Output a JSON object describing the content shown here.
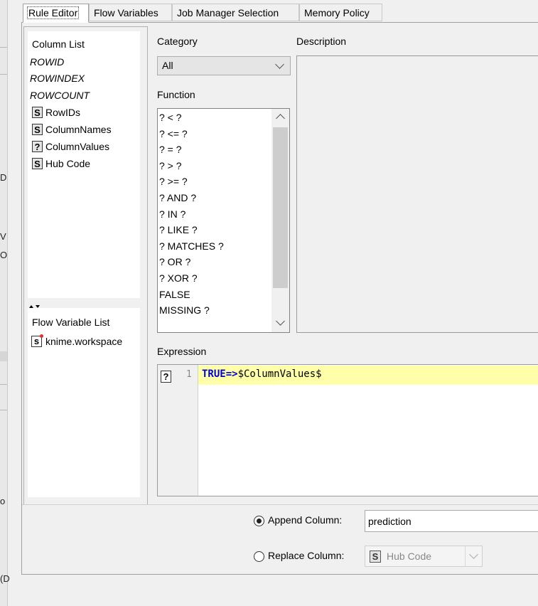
{
  "tabs": [
    {
      "label": "Rule Editor",
      "active": true
    },
    {
      "label": "Flow Variables"
    },
    {
      "label": "Job Manager Selection"
    },
    {
      "label": "Memory Policy"
    }
  ],
  "background_fragments": [
    "D",
    "V",
    "O",
    "o",
    "(D"
  ],
  "column_list": {
    "title": "Column List",
    "specials": [
      "ROWID",
      "ROWINDEX",
      "ROWCOUNT"
    ],
    "columns": [
      {
        "type": "S",
        "name": "RowIDs"
      },
      {
        "type": "S",
        "name": "ColumnNames"
      },
      {
        "type": "?",
        "name": "ColumnValues"
      },
      {
        "type": "S",
        "name": "Hub Code"
      }
    ]
  },
  "flow_variable_list": {
    "title": "Flow Variable List",
    "items": [
      {
        "type": "s",
        "name": "knime.workspace"
      }
    ]
  },
  "category": {
    "label": "Category",
    "value": "All"
  },
  "function": {
    "label": "Function",
    "items": [
      "? < ?",
      "? <= ?",
      "? = ?",
      "? > ?",
      "? >= ?",
      "? AND ?",
      "? IN ?",
      "? LIKE ?",
      "? MATCHES ?",
      "? OR ?",
      "? XOR ?",
      "FALSE",
      "MISSING ?"
    ]
  },
  "description": {
    "label": "Description"
  },
  "expression": {
    "label": "Expression",
    "gutter_badge": "?",
    "line_number": "1",
    "keyword_text": "TRUE=>",
    "ref_text": "$ColumnValues$"
  },
  "output": {
    "append_label": "Append Column:",
    "append_value": "prediction",
    "replace_label": "Replace Column:",
    "replace_badge": "S",
    "replace_value": "Hub Code",
    "selected": "append"
  },
  "colors": {
    "highlight": "#ffffaa",
    "keyword": "#0000cc"
  }
}
